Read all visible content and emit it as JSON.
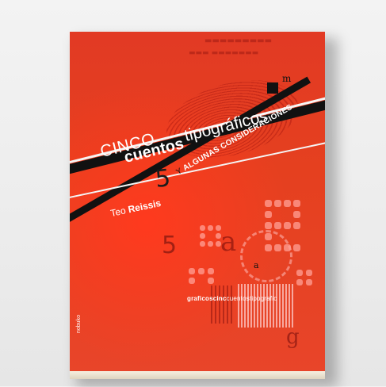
{
  "book": {
    "title_word1": "CINCO",
    "title_word2": "cuentos",
    "title_word3": "tipográficos",
    "subtitle_prefix": "Y",
    "subtitle_main": "ALGUNAS CONSIDERACIONES",
    "author_first": "Teo",
    "author_last": "Reissis",
    "number": "5",
    "promo_text": "graficoscinc",
    "promo_text_bold": "cuentostipografic",
    "publisher": "nobuko",
    "letter_m": "m",
    "letter_a": "a",
    "big_letter_a": "a",
    "big_letter_g": "g"
  },
  "colors": {
    "cover_red": "#e03a22",
    "band_black": "#111111",
    "title_white": "#ffffff",
    "background": "#efefef"
  }
}
